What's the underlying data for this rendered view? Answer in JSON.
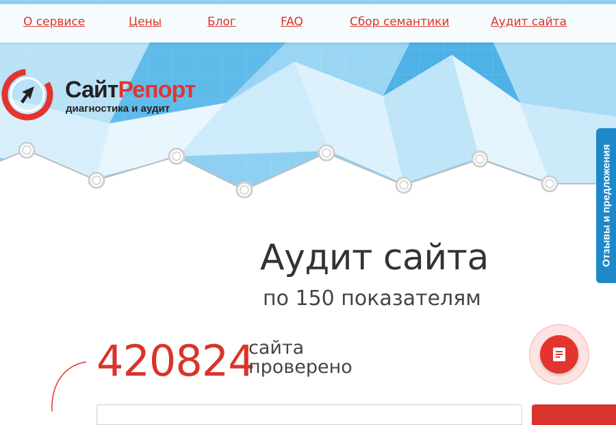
{
  "nav": {
    "items": [
      {
        "label": "О сервисе"
      },
      {
        "label": "Цены"
      },
      {
        "label": "Блог"
      },
      {
        "label": "FAQ"
      },
      {
        "label": "Сбор семантики"
      },
      {
        "label": "Аудит сайта"
      }
    ]
  },
  "logo": {
    "name_part1": "Сайт",
    "name_part2": "Репорт",
    "tagline": "диагностика и аудит"
  },
  "feedback": {
    "label": "Отзывы и предложения"
  },
  "main": {
    "title": "Аудит сайта",
    "subtitle": "по 150 показателям",
    "counter": "420824",
    "counter_label_1": "сайта",
    "counter_label_2": "проверено"
  },
  "icons": {
    "logo": "arrow-cursor-in-ring-icon",
    "chat": "chat-message-icon"
  },
  "colors": {
    "accent": "#e3342f",
    "blue": "#1e88c9",
    "sky": "#7cc8ef"
  }
}
